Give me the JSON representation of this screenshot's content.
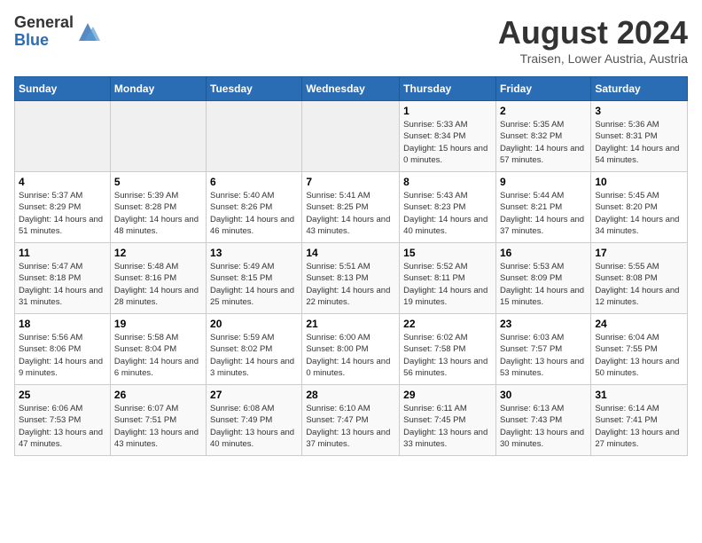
{
  "logo": {
    "general": "General",
    "blue": "Blue"
  },
  "header": {
    "month_year": "August 2024",
    "location": "Traisen, Lower Austria, Austria"
  },
  "weekdays": [
    "Sunday",
    "Monday",
    "Tuesday",
    "Wednesday",
    "Thursday",
    "Friday",
    "Saturday"
  ],
  "weeks": [
    [
      {
        "day": "",
        "sunrise": "",
        "sunset": "",
        "daylight": ""
      },
      {
        "day": "",
        "sunrise": "",
        "sunset": "",
        "daylight": ""
      },
      {
        "day": "",
        "sunrise": "",
        "sunset": "",
        "daylight": ""
      },
      {
        "day": "",
        "sunrise": "",
        "sunset": "",
        "daylight": ""
      },
      {
        "day": "1",
        "sunrise": "Sunrise: 5:33 AM",
        "sunset": "Sunset: 8:34 PM",
        "daylight": "Daylight: 15 hours and 0 minutes."
      },
      {
        "day": "2",
        "sunrise": "Sunrise: 5:35 AM",
        "sunset": "Sunset: 8:32 PM",
        "daylight": "Daylight: 14 hours and 57 minutes."
      },
      {
        "day": "3",
        "sunrise": "Sunrise: 5:36 AM",
        "sunset": "Sunset: 8:31 PM",
        "daylight": "Daylight: 14 hours and 54 minutes."
      }
    ],
    [
      {
        "day": "4",
        "sunrise": "Sunrise: 5:37 AM",
        "sunset": "Sunset: 8:29 PM",
        "daylight": "Daylight: 14 hours and 51 minutes."
      },
      {
        "day": "5",
        "sunrise": "Sunrise: 5:39 AM",
        "sunset": "Sunset: 8:28 PM",
        "daylight": "Daylight: 14 hours and 48 minutes."
      },
      {
        "day": "6",
        "sunrise": "Sunrise: 5:40 AM",
        "sunset": "Sunset: 8:26 PM",
        "daylight": "Daylight: 14 hours and 46 minutes."
      },
      {
        "day": "7",
        "sunrise": "Sunrise: 5:41 AM",
        "sunset": "Sunset: 8:25 PM",
        "daylight": "Daylight: 14 hours and 43 minutes."
      },
      {
        "day": "8",
        "sunrise": "Sunrise: 5:43 AM",
        "sunset": "Sunset: 8:23 PM",
        "daylight": "Daylight: 14 hours and 40 minutes."
      },
      {
        "day": "9",
        "sunrise": "Sunrise: 5:44 AM",
        "sunset": "Sunset: 8:21 PM",
        "daylight": "Daylight: 14 hours and 37 minutes."
      },
      {
        "day": "10",
        "sunrise": "Sunrise: 5:45 AM",
        "sunset": "Sunset: 8:20 PM",
        "daylight": "Daylight: 14 hours and 34 minutes."
      }
    ],
    [
      {
        "day": "11",
        "sunrise": "Sunrise: 5:47 AM",
        "sunset": "Sunset: 8:18 PM",
        "daylight": "Daylight: 14 hours and 31 minutes."
      },
      {
        "day": "12",
        "sunrise": "Sunrise: 5:48 AM",
        "sunset": "Sunset: 8:16 PM",
        "daylight": "Daylight: 14 hours and 28 minutes."
      },
      {
        "day": "13",
        "sunrise": "Sunrise: 5:49 AM",
        "sunset": "Sunset: 8:15 PM",
        "daylight": "Daylight: 14 hours and 25 minutes."
      },
      {
        "day": "14",
        "sunrise": "Sunrise: 5:51 AM",
        "sunset": "Sunset: 8:13 PM",
        "daylight": "Daylight: 14 hours and 22 minutes."
      },
      {
        "day": "15",
        "sunrise": "Sunrise: 5:52 AM",
        "sunset": "Sunset: 8:11 PM",
        "daylight": "Daylight: 14 hours and 19 minutes."
      },
      {
        "day": "16",
        "sunrise": "Sunrise: 5:53 AM",
        "sunset": "Sunset: 8:09 PM",
        "daylight": "Daylight: 14 hours and 15 minutes."
      },
      {
        "day": "17",
        "sunrise": "Sunrise: 5:55 AM",
        "sunset": "Sunset: 8:08 PM",
        "daylight": "Daylight: 14 hours and 12 minutes."
      }
    ],
    [
      {
        "day": "18",
        "sunrise": "Sunrise: 5:56 AM",
        "sunset": "Sunset: 8:06 PM",
        "daylight": "Daylight: 14 hours and 9 minutes."
      },
      {
        "day": "19",
        "sunrise": "Sunrise: 5:58 AM",
        "sunset": "Sunset: 8:04 PM",
        "daylight": "Daylight: 14 hours and 6 minutes."
      },
      {
        "day": "20",
        "sunrise": "Sunrise: 5:59 AM",
        "sunset": "Sunset: 8:02 PM",
        "daylight": "Daylight: 14 hours and 3 minutes."
      },
      {
        "day": "21",
        "sunrise": "Sunrise: 6:00 AM",
        "sunset": "Sunset: 8:00 PM",
        "daylight": "Daylight: 14 hours and 0 minutes."
      },
      {
        "day": "22",
        "sunrise": "Sunrise: 6:02 AM",
        "sunset": "Sunset: 7:58 PM",
        "daylight": "Daylight: 13 hours and 56 minutes."
      },
      {
        "day": "23",
        "sunrise": "Sunrise: 6:03 AM",
        "sunset": "Sunset: 7:57 PM",
        "daylight": "Daylight: 13 hours and 53 minutes."
      },
      {
        "day": "24",
        "sunrise": "Sunrise: 6:04 AM",
        "sunset": "Sunset: 7:55 PM",
        "daylight": "Daylight: 13 hours and 50 minutes."
      }
    ],
    [
      {
        "day": "25",
        "sunrise": "Sunrise: 6:06 AM",
        "sunset": "Sunset: 7:53 PM",
        "daylight": "Daylight: 13 hours and 47 minutes."
      },
      {
        "day": "26",
        "sunrise": "Sunrise: 6:07 AM",
        "sunset": "Sunset: 7:51 PM",
        "daylight": "Daylight: 13 hours and 43 minutes."
      },
      {
        "day": "27",
        "sunrise": "Sunrise: 6:08 AM",
        "sunset": "Sunset: 7:49 PM",
        "daylight": "Daylight: 13 hours and 40 minutes."
      },
      {
        "day": "28",
        "sunrise": "Sunrise: 6:10 AM",
        "sunset": "Sunset: 7:47 PM",
        "daylight": "Daylight: 13 hours and 37 minutes."
      },
      {
        "day": "29",
        "sunrise": "Sunrise: 6:11 AM",
        "sunset": "Sunset: 7:45 PM",
        "daylight": "Daylight: 13 hours and 33 minutes."
      },
      {
        "day": "30",
        "sunrise": "Sunrise: 6:13 AM",
        "sunset": "Sunset: 7:43 PM",
        "daylight": "Daylight: 13 hours and 30 minutes."
      },
      {
        "day": "31",
        "sunrise": "Sunrise: 6:14 AM",
        "sunset": "Sunset: 7:41 PM",
        "daylight": "Daylight: 13 hours and 27 minutes."
      }
    ]
  ]
}
